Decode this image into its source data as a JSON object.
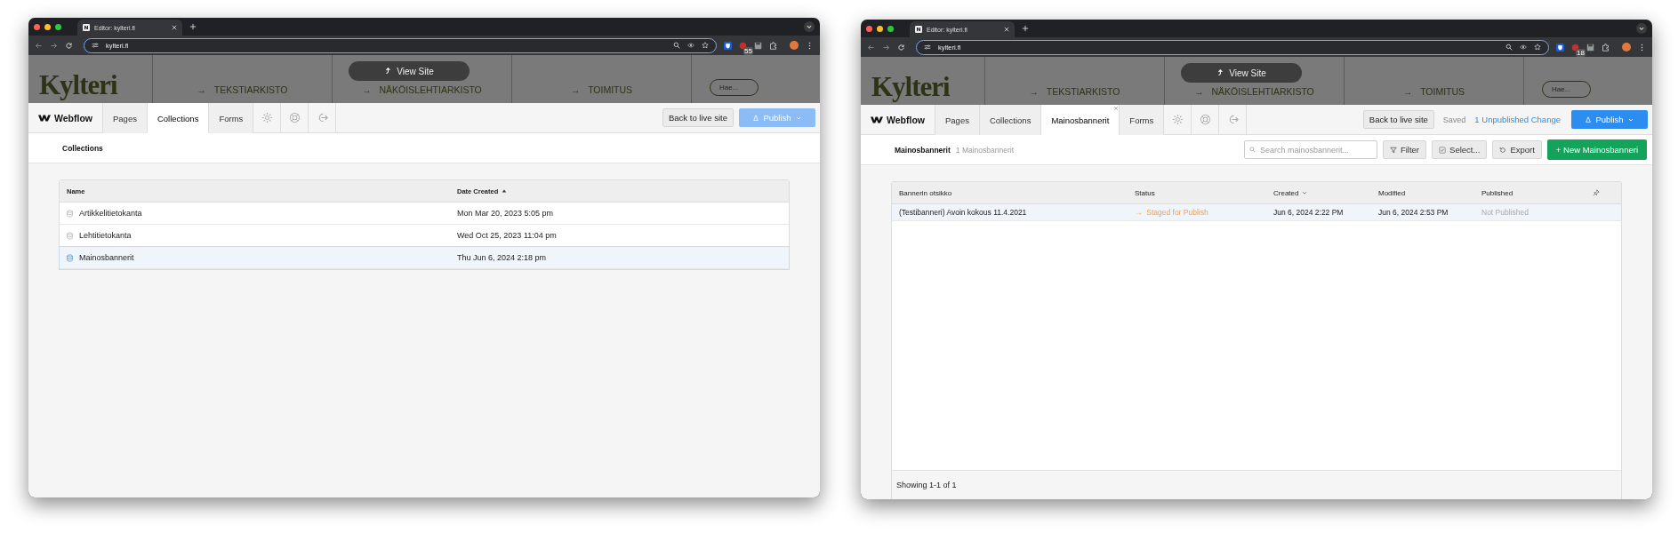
{
  "windows": [
    {
      "kind": "collections",
      "tab_title": "Editor: kylteri.fi",
      "url": "kylteri.fi",
      "extension_badge": "55",
      "site": {
        "logo": "Kylteri",
        "nav": [
          {
            "arrow": "→",
            "label": "TEKSTIARKISTO"
          },
          {
            "arrow": "→",
            "label": "NÄKÖISLEHTIARKISTO"
          },
          {
            "arrow": "→",
            "label": "TOIMITUS"
          }
        ],
        "search_placeholder": "Hae...",
        "view_site": "View Site"
      },
      "editor": {
        "brand": "Webflow",
        "tabs": [
          {
            "label": "Pages",
            "selected": false,
            "closable": false
          },
          {
            "label": "Collections",
            "selected": true,
            "closable": false
          },
          {
            "label": "Forms",
            "selected": false,
            "closable": false
          }
        ],
        "back": "Back to live site",
        "publish": {
          "label": "Publish",
          "disabled": true
        }
      },
      "header": {
        "title": "Collections"
      },
      "table": {
        "columns": [
          {
            "label": "Name",
            "sorted": false
          },
          {
            "label": "Date Created",
            "sorted": true,
            "ascending": true
          }
        ],
        "rows": [
          {
            "name": "Artikkelitietokanta",
            "date": "Mon Mar 20, 2023 5:05 pm",
            "selected": false
          },
          {
            "name": "Lehtitietokanta",
            "date": "Wed Oct 25, 2023 11:04 pm",
            "selected": false
          },
          {
            "name": "Mainosbannerit",
            "date": "Thu Jun 6, 2024 2:18 pm",
            "selected": true
          }
        ]
      }
    },
    {
      "kind": "items",
      "tab_title": "Editor: kylteri.fi",
      "url": "kylteri.fi",
      "extension_badge": "18",
      "site": {
        "logo": "Kylteri",
        "nav": [
          {
            "arrow": "→",
            "label": "TEKSTIARKISTO"
          },
          {
            "arrow": "→",
            "label": "NÄKÖISLEHTIARKISTO"
          },
          {
            "arrow": "→",
            "label": "TOIMITUS"
          }
        ],
        "search_placeholder": "Hae...",
        "view_site": "View Site"
      },
      "editor": {
        "brand": "Webflow",
        "tabs": [
          {
            "label": "Pages",
            "selected": false,
            "closable": false
          },
          {
            "label": "Collections",
            "selected": false,
            "closable": false
          },
          {
            "label": "Mainosbannerit",
            "selected": true,
            "closable": true
          },
          {
            "label": "Forms",
            "selected": false,
            "closable": false
          }
        ],
        "back": "Back to live site",
        "saved": "Saved",
        "unpublished": "1 Unpublished Change",
        "publish": {
          "label": "Publish",
          "disabled": false
        }
      },
      "header": {
        "title": "Mainosbannerit",
        "count": "1 Mainosbannerit",
        "search_placeholder": "Search mainosbannerit...",
        "filter": "Filter",
        "select": "Select...",
        "export": "Export",
        "new": "+ New Mainosbanneri"
      },
      "table": {
        "columns": [
          {
            "label": "Bannerin otsikko",
            "sorted": false
          },
          {
            "label": "Status",
            "sorted": false
          },
          {
            "label": "Created",
            "sorted": true,
            "ascending": false
          },
          {
            "label": "Modified",
            "sorted": false
          },
          {
            "label": "Published",
            "sorted": false
          }
        ],
        "rows": [
          {
            "title": "(Testibanneri) Avoin kokous 11.4.2021",
            "status": {
              "arrow": "→",
              "label": "Staged for Publish",
              "kind": "staged"
            },
            "created": "Jun 6, 2024 2:22 PM",
            "modified": "Jun 6, 2024 2:53 PM",
            "published": {
              "label": "Not Published",
              "kind": "unpublished"
            },
            "selected": true
          }
        ],
        "footer": "Showing 1-1 of 1"
      }
    }
  ]
}
